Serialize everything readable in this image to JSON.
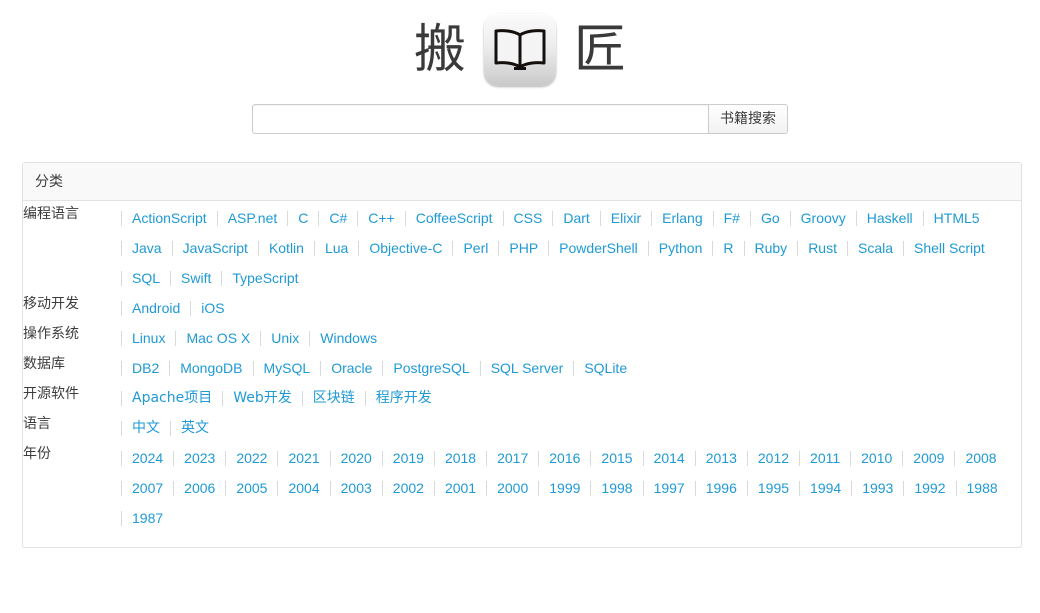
{
  "site": {
    "logo_left_char": "搬",
    "logo_icon": "open-book-icon",
    "logo_right_char": "匠"
  },
  "search": {
    "value": "",
    "placeholder": "",
    "button_label": "书籍搜索"
  },
  "panel": {
    "title": "分类",
    "rows": [
      {
        "label": "编程语言",
        "items": [
          "ActionScript",
          "ASP.net",
          "C",
          "C#",
          "C++",
          "CoffeeScript",
          "CSS",
          "Dart",
          "Elixir",
          "Erlang",
          "F#",
          "Go",
          "Groovy",
          "Haskell",
          "HTML5",
          "Java",
          "JavaScript",
          "Kotlin",
          "Lua",
          "Objective-C",
          "Perl",
          "PHP",
          "PowderShell",
          "Python",
          "R",
          "Ruby",
          "Rust",
          "Scala",
          "Shell Script",
          "SQL",
          "Swift",
          "TypeScript"
        ]
      },
      {
        "label": "移动开发",
        "items": [
          "Android",
          "iOS"
        ]
      },
      {
        "label": "操作系统",
        "items": [
          "Linux",
          "Mac OS X",
          "Unix",
          "Windows"
        ]
      },
      {
        "label": "数据库",
        "items": [
          "DB2",
          "MongoDB",
          "MySQL",
          "Oracle",
          "PostgreSQL",
          "SQL Server",
          "SQLite"
        ]
      },
      {
        "label": "开源软件",
        "items": [
          "Apache项目",
          "Web开发",
          "区块链",
          "程序开发"
        ]
      },
      {
        "label": "语言",
        "items": [
          "中文",
          "英文"
        ]
      },
      {
        "label": "年份",
        "items": [
          "2024",
          "2023",
          "2022",
          "2021",
          "2020",
          "2019",
          "2018",
          "2017",
          "2016",
          "2015",
          "2014",
          "2013",
          "2012",
          "2011",
          "2010",
          "2009",
          "2008",
          "2007",
          "2006",
          "2005",
          "2004",
          "2003",
          "2002",
          "2001",
          "2000",
          "1999",
          "1998",
          "1997",
          "1996",
          "1995",
          "1994",
          "1993",
          "1992",
          "1988",
          "1987"
        ]
      }
    ]
  },
  "colors": {
    "link": "#1f9ad6",
    "text": "#3c3c3c",
    "panel_border": "#e2e2e2",
    "panel_head_bg": "#f9f9f9",
    "divider": "#d9d9d9"
  }
}
